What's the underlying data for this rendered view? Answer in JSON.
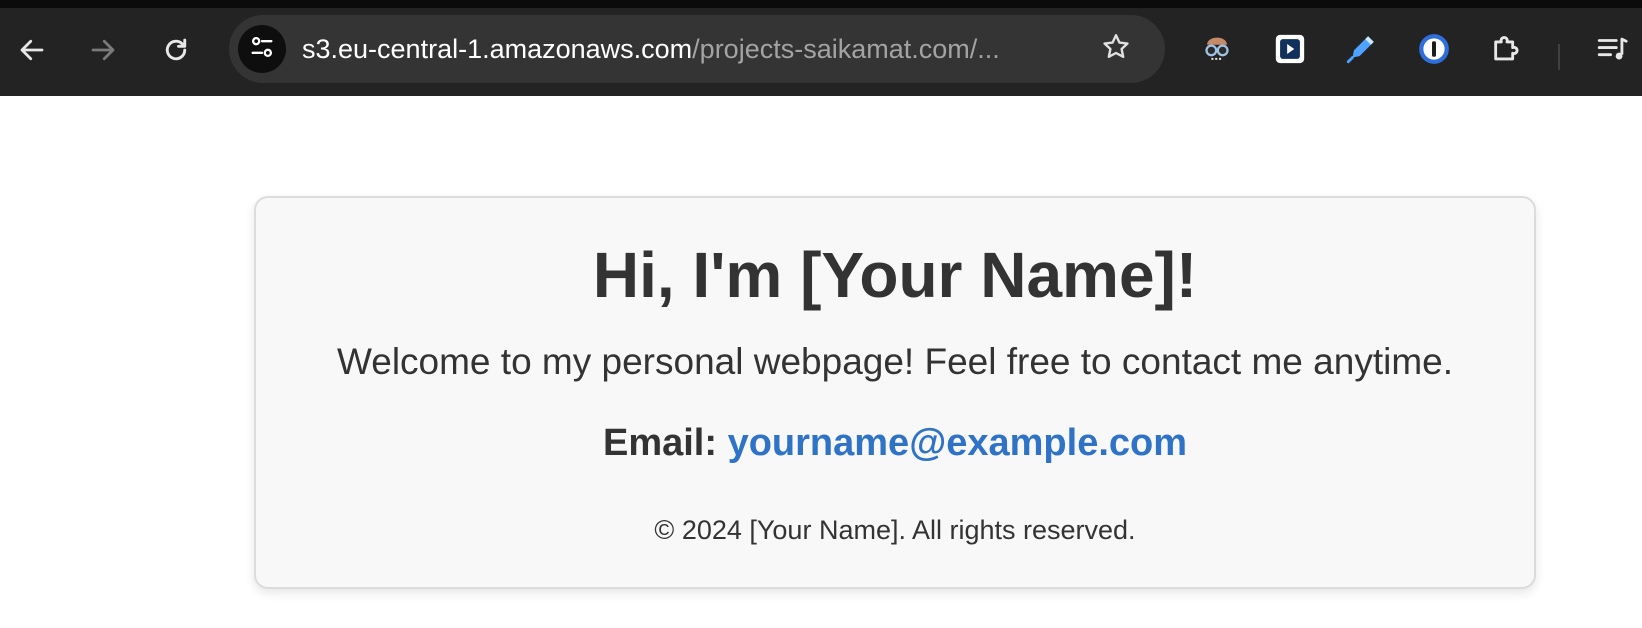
{
  "browser": {
    "url_host": "s3.eu-central-1.amazonaws.com",
    "url_path": "/projects-saikamat.com/...",
    "buttons": {
      "back": "back-arrow-icon",
      "forward": "forward-arrow-icon",
      "reload": "reload-icon",
      "site_info": "tune-icon",
      "bookmark": "star-icon"
    },
    "extensions": [
      "spy-glasses-icon",
      "play-box-icon",
      "highlighter-pen-icon",
      "password-manager-icon",
      "puzzle-piece-icon",
      "media-queue-icon"
    ]
  },
  "page": {
    "heading": "Hi, I'm [Your Name]!",
    "welcome": "Welcome to my personal webpage! Feel free to contact me anytime.",
    "email_label": "Email:",
    "email_address": "yourname@example.com",
    "footer": "© 2024 [Your Name]. All rights reserved."
  },
  "colors": {
    "chrome_bg": "#232323",
    "omnibox_bg": "#343434",
    "card_bg": "#f8f8f8",
    "text": "#333333",
    "link": "#2f73c7"
  }
}
